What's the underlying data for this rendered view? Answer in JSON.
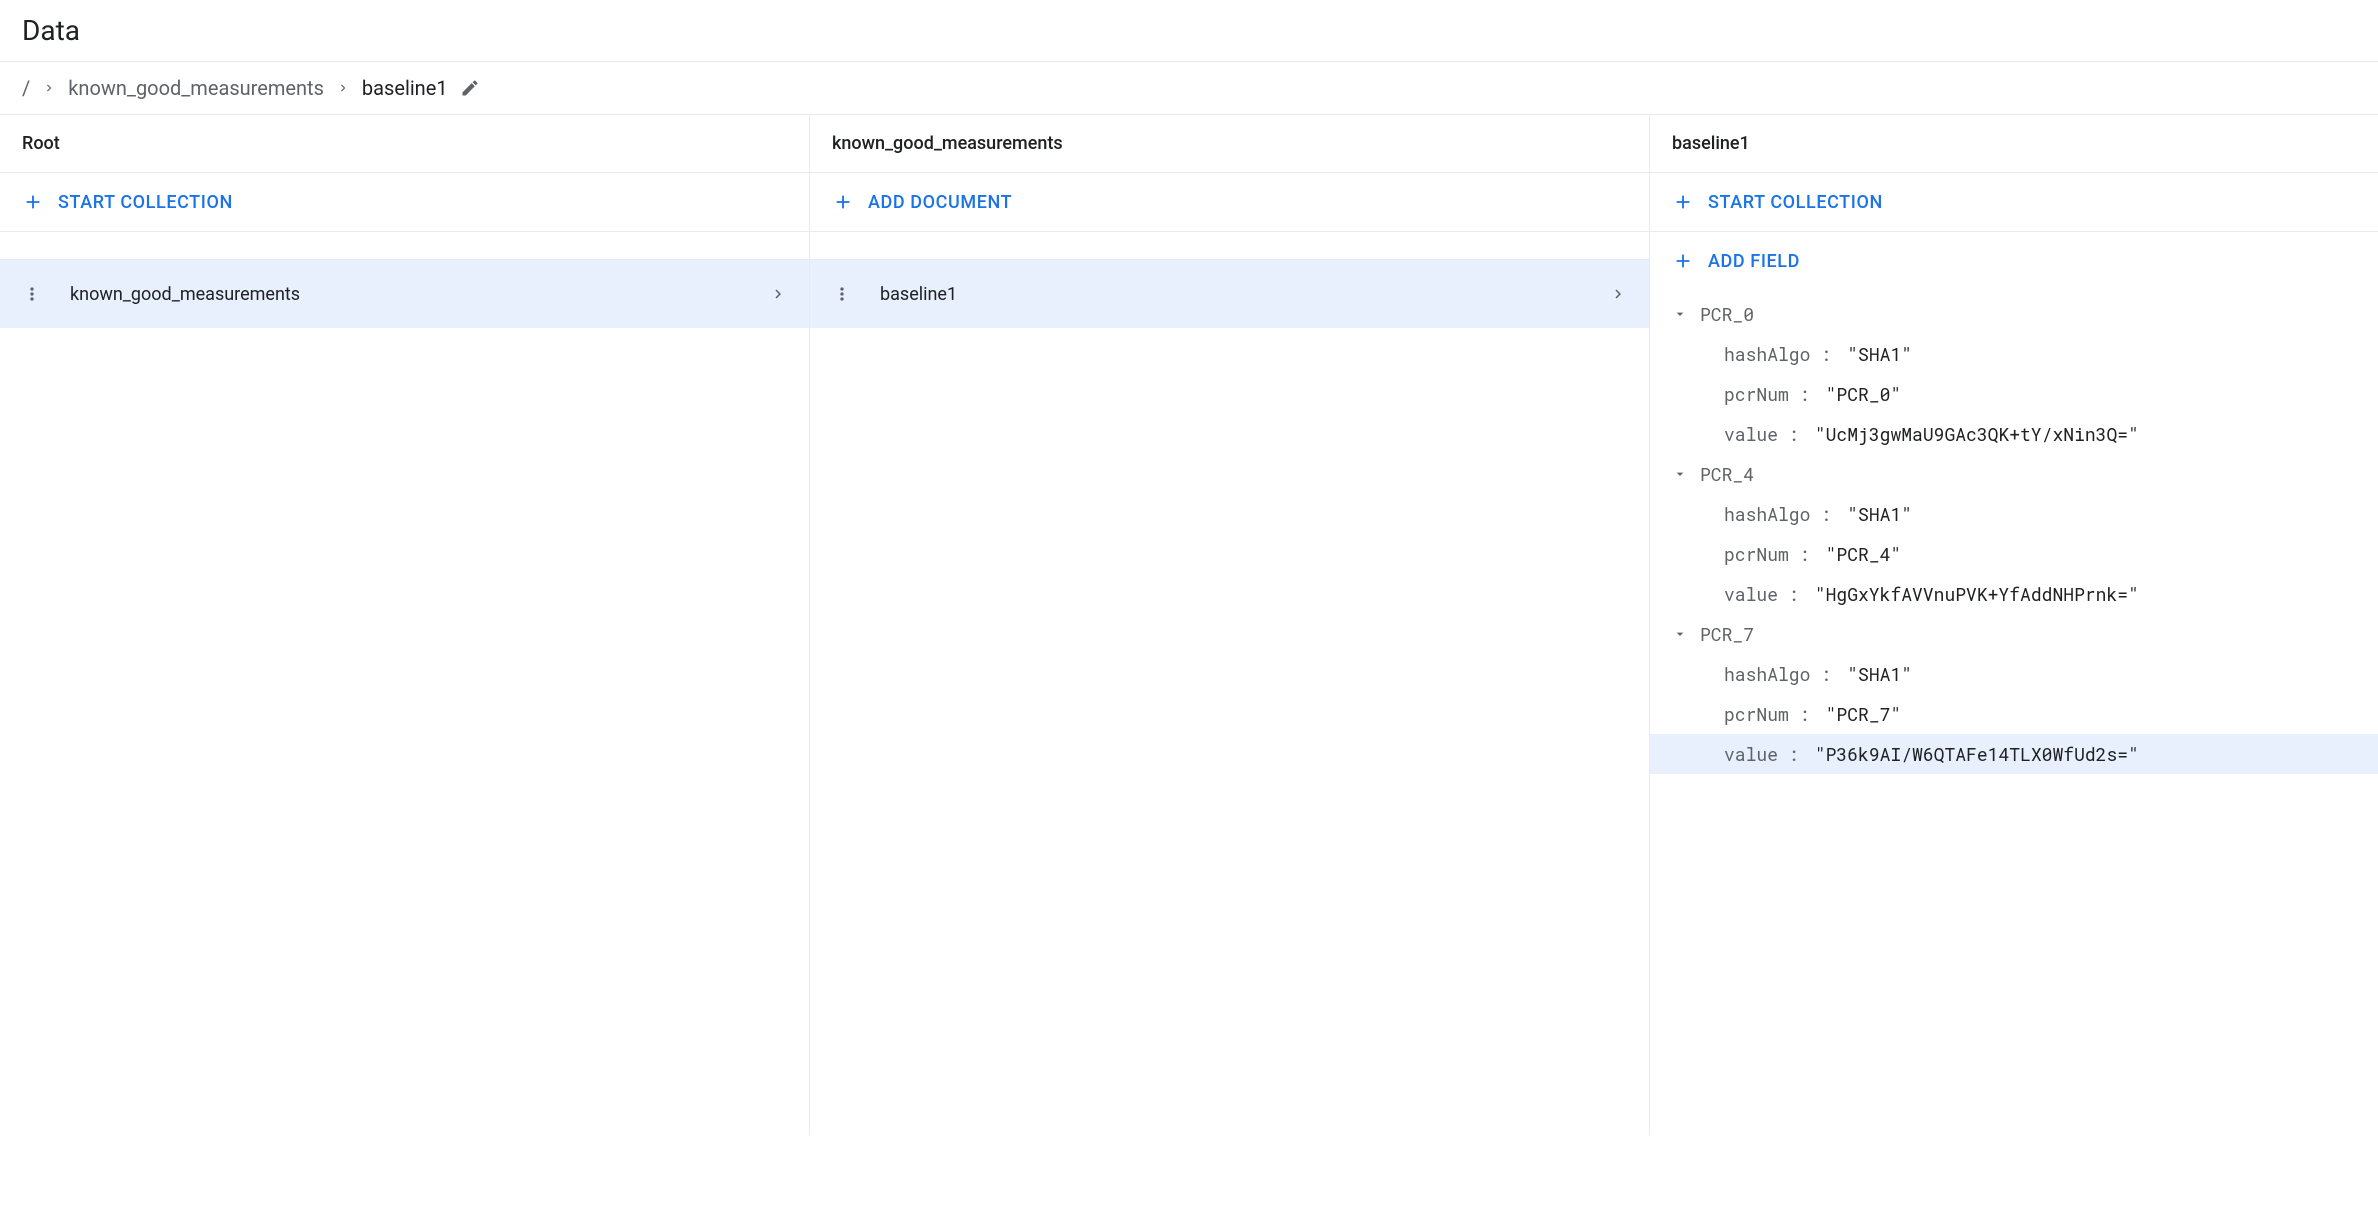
{
  "header": {
    "title": "Data"
  },
  "breadcrumb": {
    "root": "/",
    "collection": "known_good_measurements",
    "document": "baseline1"
  },
  "columns": {
    "root": {
      "title": "Root",
      "action": "START COLLECTION",
      "items": [
        {
          "label": "known_good_measurements",
          "selected": true
        }
      ]
    },
    "collection": {
      "title": "known_good_measurements",
      "action": "ADD DOCUMENT",
      "items": [
        {
          "label": "baseline1",
          "selected": true
        }
      ]
    },
    "document": {
      "title": "baseline1",
      "action_collection": "START COLLECTION",
      "action_field": "ADD FIELD",
      "fields": [
        {
          "name": "PCR_0",
          "children": [
            {
              "key": "hashAlgo",
              "value": "\"SHA1\""
            },
            {
              "key": "pcrNum",
              "value": "\"PCR_0\""
            },
            {
              "key": "value",
              "value": "\"UcMj3gwMaU9GAc3QK+tY/xNin3Q=\""
            }
          ]
        },
        {
          "name": "PCR_4",
          "children": [
            {
              "key": "hashAlgo",
              "value": "\"SHA1\""
            },
            {
              "key": "pcrNum",
              "value": "\"PCR_4\""
            },
            {
              "key": "value",
              "value": "\"HgGxYkfAVVnuPVK+YfAddNHPrnk=\""
            }
          ]
        },
        {
          "name": "PCR_7",
          "children": [
            {
              "key": "hashAlgo",
              "value": "\"SHA1\""
            },
            {
              "key": "pcrNum",
              "value": "\"PCR_7\""
            },
            {
              "key": "value",
              "value": "\"P36k9AI/W6QTAFe14TLX0WfUd2s=\"",
              "hovered": true
            }
          ]
        }
      ]
    }
  }
}
